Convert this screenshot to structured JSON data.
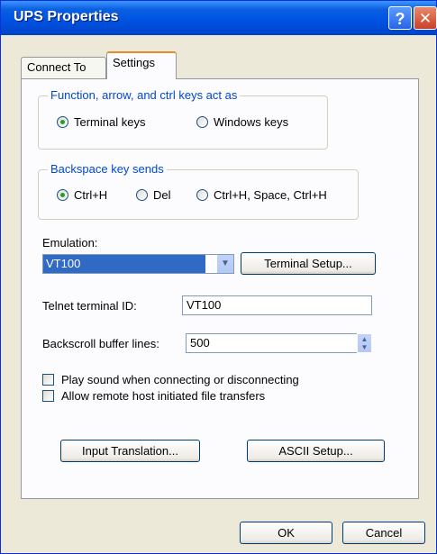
{
  "window": {
    "title": "UPS Properties",
    "help_label": "?",
    "close_label": "✕"
  },
  "tabs": [
    {
      "label": "Connect To"
    },
    {
      "label": "Settings"
    }
  ],
  "function_keys": {
    "legend": "Function, arrow, and ctrl keys act as",
    "options": [
      {
        "label": "Terminal keys",
        "selected": true
      },
      {
        "label": "Windows keys",
        "selected": false
      }
    ]
  },
  "backspace": {
    "legend": "Backspace key sends",
    "options": [
      {
        "label": "Ctrl+H",
        "selected": true
      },
      {
        "label": "Del",
        "selected": false
      },
      {
        "label": "Ctrl+H, Space, Ctrl+H",
        "selected": false
      }
    ]
  },
  "emulation": {
    "label": "Emulation:",
    "value": "VT100",
    "setup_button": "Terminal Setup..."
  },
  "telnet": {
    "label": "Telnet terminal ID:",
    "value": "VT100"
  },
  "backscroll": {
    "label": "Backscroll buffer lines:",
    "value": "500"
  },
  "checkboxes": [
    {
      "label": "Play sound when connecting or disconnecting",
      "checked": false
    },
    {
      "label": "Allow remote host initiated file transfers",
      "checked": false
    }
  ],
  "buttons": {
    "input_translation": "Input Translation...",
    "ascii_setup": "ASCII Setup...",
    "ok": "OK",
    "cancel": "Cancel"
  },
  "colors": {
    "titlebar": "#0054e3",
    "selection": "#316ac5",
    "group_legend": "#0046d5",
    "active_tab_accent": "#e68b2c"
  }
}
